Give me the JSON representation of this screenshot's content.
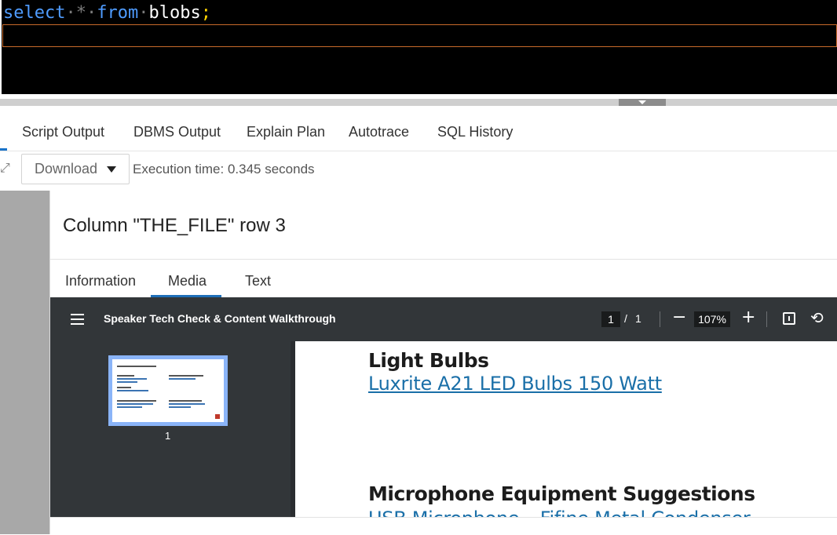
{
  "editor": {
    "keyword_select": "select",
    "star": "*",
    "keyword_from": "from",
    "table": "blobs",
    "semicolon": ";"
  },
  "tabs": [
    "Script Output",
    "DBMS Output",
    "Explain Plan",
    "Autotrace",
    "SQL History"
  ],
  "toolbar": {
    "download_label": "Download",
    "execution_time": "Execution time: 0.345 seconds"
  },
  "viewer": {
    "title": "Column \"THE_FILE\" row 3",
    "subtabs": [
      "Information",
      "Media",
      "Text"
    ],
    "active_subtab": "Media"
  },
  "pdf": {
    "title": "Speaker Tech Check & Content Walkthrough",
    "current_page": "1",
    "page_separator": "/",
    "total_pages": "1",
    "zoom": "107%",
    "thumbnail_page_label": "1",
    "content": {
      "heading1": "Light Bulbs",
      "link1": "Luxrite A21 LED Bulbs 150 Watt",
      "heading2": "Microphone Equipment Suggestions",
      "link2": "USB Microphone – Fifine Metal Condenser"
    }
  },
  "icons": {
    "menu": "hamburger-menu-icon",
    "zoom_out": "minus-icon",
    "zoom_in": "plus-icon",
    "fit": "fit-page-icon",
    "rotate": "rotate-icon",
    "toolbar_left": "expand-icon"
  },
  "colors": {
    "editor_bg": "#000000",
    "keyword": "#4f9cff",
    "semicolon": "#ffd400",
    "current_line_border": "#c86a2a",
    "active_tab_accent": "#1f6fb8",
    "pdf_toolbar": "#323639",
    "link": "#1a6fa8"
  }
}
